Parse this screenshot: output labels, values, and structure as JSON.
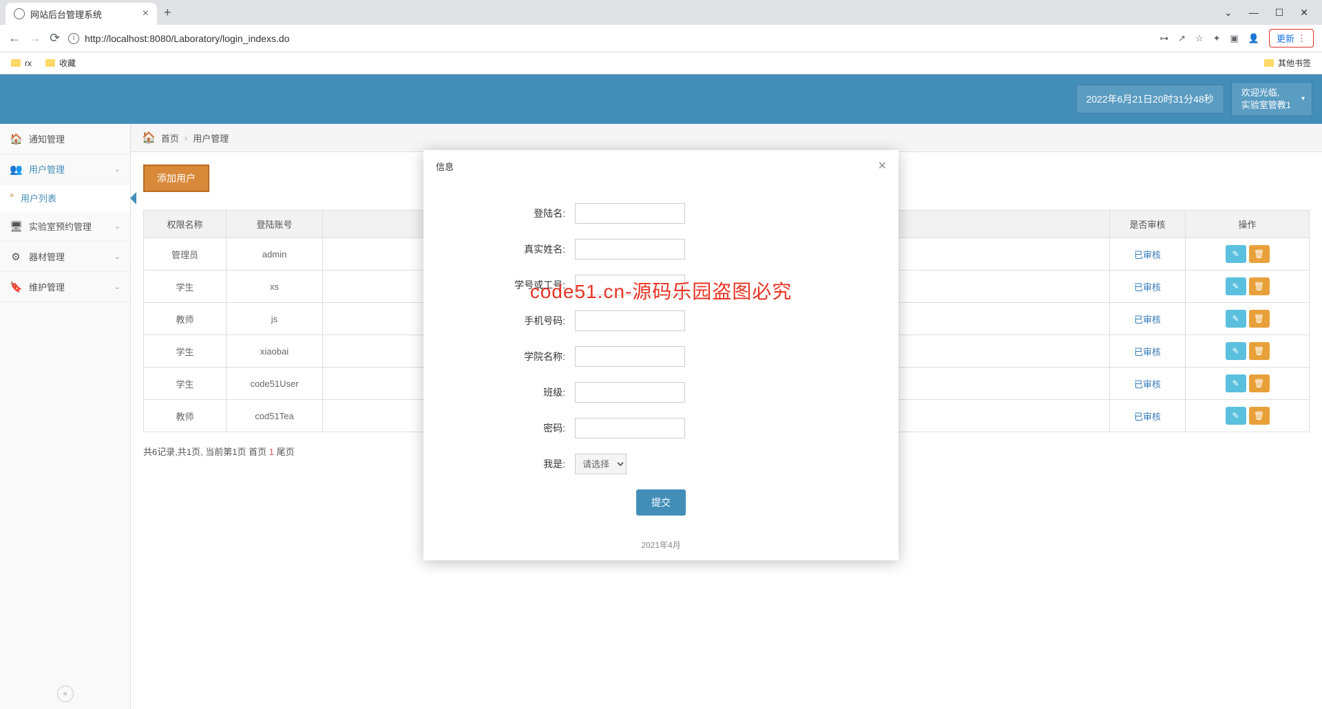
{
  "browser": {
    "tab_title": "网站后台管理系统",
    "url": "http://localhost:8080/Laboratory/login_indexs.do",
    "update_label": "更新",
    "bookmarks": {
      "rx": "rx",
      "fav": "收藏",
      "other": "其他书签"
    }
  },
  "header": {
    "datetime": "2022年6月21日20时31分48秒",
    "welcome": "欢迎光临,",
    "username": "实验室管教1"
  },
  "sidebar": {
    "items": [
      {
        "icon": "🏠",
        "label": "通知管理"
      },
      {
        "icon": "👥",
        "label": "用户管理"
      },
      {
        "icon": "🖥",
        "label": "实验室预约管理"
      },
      {
        "icon": "⚙",
        "label": "器材管理"
      },
      {
        "icon": "🔖",
        "label": "维护管理"
      }
    ],
    "sub_user_list": "用户列表"
  },
  "breadcrumb": {
    "home": "首页",
    "current": "用户管理"
  },
  "toolbar": {
    "add_user": "添加用户"
  },
  "table": {
    "headers": {
      "role": "权限名称",
      "account": "登陆账号",
      "audit": "是否审核",
      "ops": "操作"
    },
    "rows": [
      {
        "role": "管理员",
        "account": "admin",
        "audit": "已审核"
      },
      {
        "role": "学生",
        "account": "xs",
        "audit": "已审核"
      },
      {
        "role": "教师",
        "account": "js",
        "audit": "已审核"
      },
      {
        "role": "学生",
        "account": "xiaobai",
        "audit": "已审核"
      },
      {
        "role": "学生",
        "account": "code51User",
        "audit": "已审核"
      },
      {
        "role": "教师",
        "account": "cod51Tea",
        "audit": "已审核"
      }
    ]
  },
  "pager": {
    "text_a": "共6记录,共1页, 当前第1页 首页 ",
    "cur": "1",
    "text_b": " 尾页"
  },
  "modal": {
    "title": "信息",
    "fields": {
      "login": "登陆名:",
      "realname": "真实姓名:",
      "studentid": "学号或工号:",
      "phone": "手机号码:",
      "college": "学院名称:",
      "class": "班级:",
      "password": "密码:",
      "iam": "我是:"
    },
    "select_placeholder": "请选择",
    "submit": "提交",
    "footer": "2021年4月"
  },
  "watermark": "code51.cn-源码乐园盗图必究"
}
